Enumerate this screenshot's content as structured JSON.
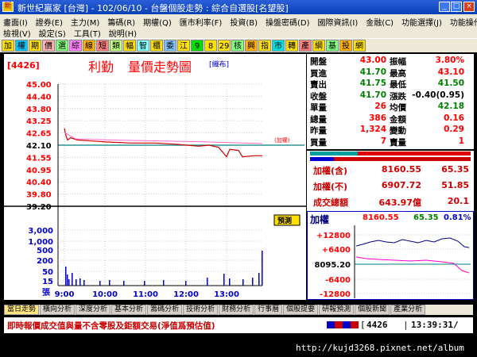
{
  "window": {
    "title": "新世紀贏家 [台灣] - 102/06/10 - 台盤個股走勢 : 綜合自選股[名望股]"
  },
  "menu": {
    "row1": [
      "畫面(I)",
      "證券(E)",
      "主力(M)",
      "籌碼(R)",
      "期權(Q)",
      "匯市利率(F)",
      "投資(B)",
      "操盤密碼(D)",
      "國際資訊(I)",
      "金融(C)",
      "功能選擇(J)",
      "功能操作(K)"
    ],
    "row2": [
      "檢視(V)",
      "設定(S)",
      "工具(T)",
      "說明(H)"
    ]
  },
  "toolbar": {
    "buttons": [
      "加",
      "權",
      "期",
      "價",
      "選",
      "綜",
      "線",
      "短",
      "類",
      "幅",
      "智",
      "櫃",
      "委",
      "江",
      "9",
      "8",
      "29",
      "核",
      "興",
      "指",
      "市",
      "轉",
      "產",
      "綱",
      "基",
      "投",
      "網"
    ]
  },
  "chart": {
    "code": "[4426]",
    "stock_name": "利勤",
    "title": "量價走勢圖",
    "tag": "[織布]",
    "price_ticks": [
      "45.00",
      "44.40",
      "43.80",
      "43.25",
      "42.65",
      "42.10",
      "41.55",
      "40.95",
      "40.40",
      "39.80",
      "39.20"
    ],
    "volume_ticks": [
      "3,000",
      "1,000",
      "500",
      "200",
      "50",
      "15"
    ],
    "volume_unit": "張",
    "time_ticks": [
      "9:00",
      "10:00",
      "11:00",
      "12:00",
      "13:00"
    ],
    "reference_label": "(加權)",
    "forecast_button": "預測"
  },
  "quote": {
    "rows": [
      {
        "l1": "開盤",
        "v1": "43.00",
        "c1": "#ff0000",
        "l2": "振幅",
        "v2": "3.80%",
        "c2": "#ff0000"
      },
      {
        "l1": "買進",
        "v1": "41.70",
        "c1": "#008000",
        "l2": "最高",
        "v2": "43.10",
        "c2": "#ff0000"
      },
      {
        "l1": "賣出",
        "v1": "41.75",
        "c1": "#008000",
        "l2": "最低",
        "v2": "41.50",
        "c2": "#008000"
      },
      {
        "l1": "收盤",
        "v1": "41.70",
        "c1": "#008000",
        "l2": "漲跌",
        "v2": "-0.40(0.95)",
        "c2": "#000000"
      },
      {
        "l1": "單量",
        "v1": "26",
        "c1": "#ff0000",
        "l2": "均價",
        "v2": "42.18",
        "c2": "#008000"
      },
      {
        "l1": "總量",
        "v1": "386",
        "c1": "#ff0000",
        "l2": "金額",
        "v2": "0.16",
        "c2": "#ff0000"
      },
      {
        "l1": "昨量",
        "v1": "1,324",
        "c1": "#ff0000",
        "l2": "變動",
        "v2": "0.29",
        "c2": "#ff0000"
      },
      {
        "l1": "買量",
        "v1": "7",
        "c1": "#ff0000",
        "l2": "賣量",
        "v2": "1",
        "c2": "#ff0000"
      }
    ]
  },
  "index": {
    "rows": [
      {
        "label": "加權(含)",
        "value": "8160.55",
        "change": "65.35"
      },
      {
        "label": "加權(不)",
        "value": "6907.72",
        "change": "51.85"
      },
      {
        "label": "成交總額",
        "value": "643.97億",
        "change": "20.1"
      }
    ]
  },
  "mini": {
    "label": "加權",
    "value": "8160.55",
    "change": "65.35",
    "pct": "0.81%",
    "ticks": [
      "+12800",
      "+6400",
      "8095.20",
      "-6400",
      "-12800"
    ]
  },
  "tabs": [
    "當日走勢",
    "橫向分析",
    "深度分析",
    "基本分析",
    "籌碼分析",
    "技術分析",
    "財務分析",
    "行事曆",
    "個股提要",
    "研報預測",
    "個股新聞",
    "產業分析"
  ],
  "status": {
    "message": "即時報價成交值與量不含零股及鉅額交易(淨值爲預估值)",
    "code": "4426",
    "time": "13:39:31/"
  },
  "footer": {
    "watermark": "http://kujd3268.pixnet.net/album"
  },
  "colors": {
    "up": "#ff0000",
    "down": "#008000",
    "price_line": "#d00000",
    "avg_line": "#ff66cc",
    "volume": "#0000cc"
  }
}
